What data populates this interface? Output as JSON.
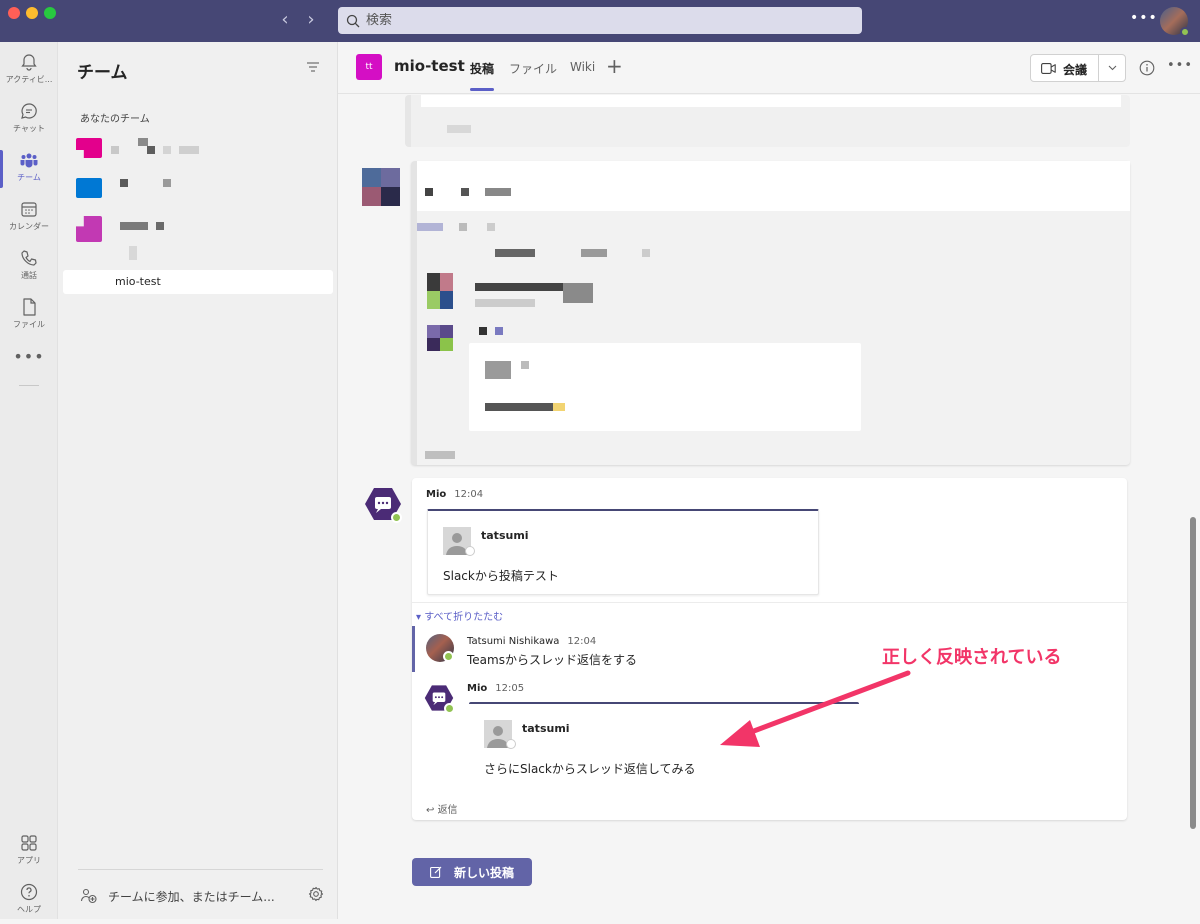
{
  "search": {
    "placeholder": "検索"
  },
  "rail": {
    "items": [
      {
        "label": "アクティビ..."
      },
      {
        "label": "チャット"
      },
      {
        "label": "チーム"
      },
      {
        "label": "カレンダー"
      },
      {
        "label": "通話"
      },
      {
        "label": "ファイル"
      }
    ],
    "apps_label": "アプリ",
    "help_label": "ヘルプ"
  },
  "teams_panel": {
    "title": "チーム",
    "section_label": "あなたのチーム",
    "team_colors": [
      "#e3008c",
      "#0078d4",
      "#c239b3"
    ],
    "selected_channel": "mio-test",
    "join_label": "チームに参加、またはチーム..."
  },
  "channel": {
    "avatar_initials": "tt",
    "name": "mio-test",
    "tabs": [
      {
        "label": "投稿",
        "active": true
      },
      {
        "label": "ファイル",
        "active": false
      },
      {
        "label": "Wiki",
        "active": false
      }
    ],
    "meet_label": "会議"
  },
  "thread": {
    "root": {
      "sender": "Mio",
      "time": "12:04",
      "card_name": "tatsumi",
      "card_text": "Slackから投稿テスト"
    },
    "collapse_label": "すべて折りたたむ",
    "replies": [
      {
        "sender": "Tatsumi Nishikawa",
        "time": "12:04",
        "text": "Teamsからスレッド返信をする"
      },
      {
        "sender": "Mio",
        "time": "12:05",
        "card_name": "tatsumi",
        "card_text": "さらにSlackからスレッド返信してみる"
      }
    ],
    "reply_label": "返信"
  },
  "annotation": "正しく反映されている",
  "new_post_label": "新しい投稿",
  "colors": {
    "brand": "#464775",
    "accent": "#6264a7",
    "annotation": "#f23568",
    "presence": "#92c353"
  }
}
